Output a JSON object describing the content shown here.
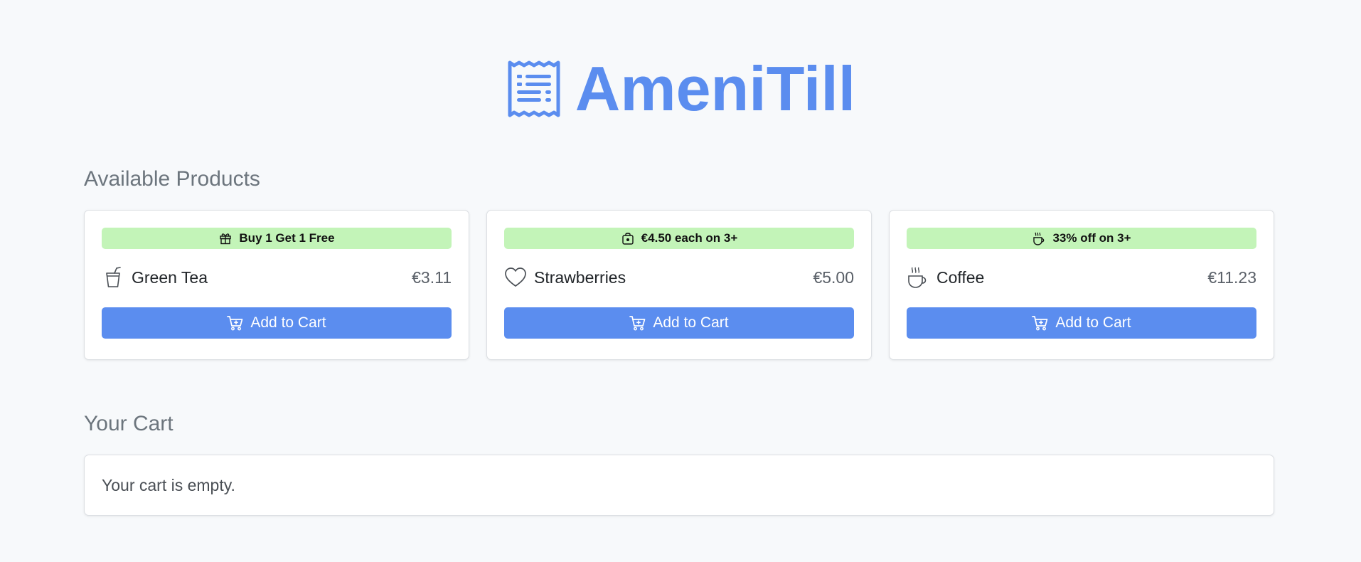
{
  "app": {
    "title": "AmeniTill",
    "logo_icon": "receipt-icon",
    "accent_color": "#5b8def",
    "badge_color": "#c3f4b8"
  },
  "products_section": {
    "title": "Available Products",
    "items": [
      {
        "name": "Green Tea",
        "price": "€3.11",
        "icon": "cup-straw-icon",
        "badge": "Buy 1 Get 1 Free",
        "badge_icon": "gift-icon",
        "button_label": "Add to Cart"
      },
      {
        "name": "Strawberries",
        "price": "€5.00",
        "icon": "heart-icon",
        "badge": "€4.50 each on 3+",
        "badge_icon": "bag-icon",
        "button_label": "Add to Cart"
      },
      {
        "name": "Coffee",
        "price": "€11.23",
        "icon": "hot-cup-icon",
        "badge": "33% off on 3+",
        "badge_icon": "hot-cup-icon",
        "button_label": "Add to Cart"
      }
    ]
  },
  "cart_section": {
    "title": "Your Cart",
    "empty_message": "Your cart is empty."
  }
}
